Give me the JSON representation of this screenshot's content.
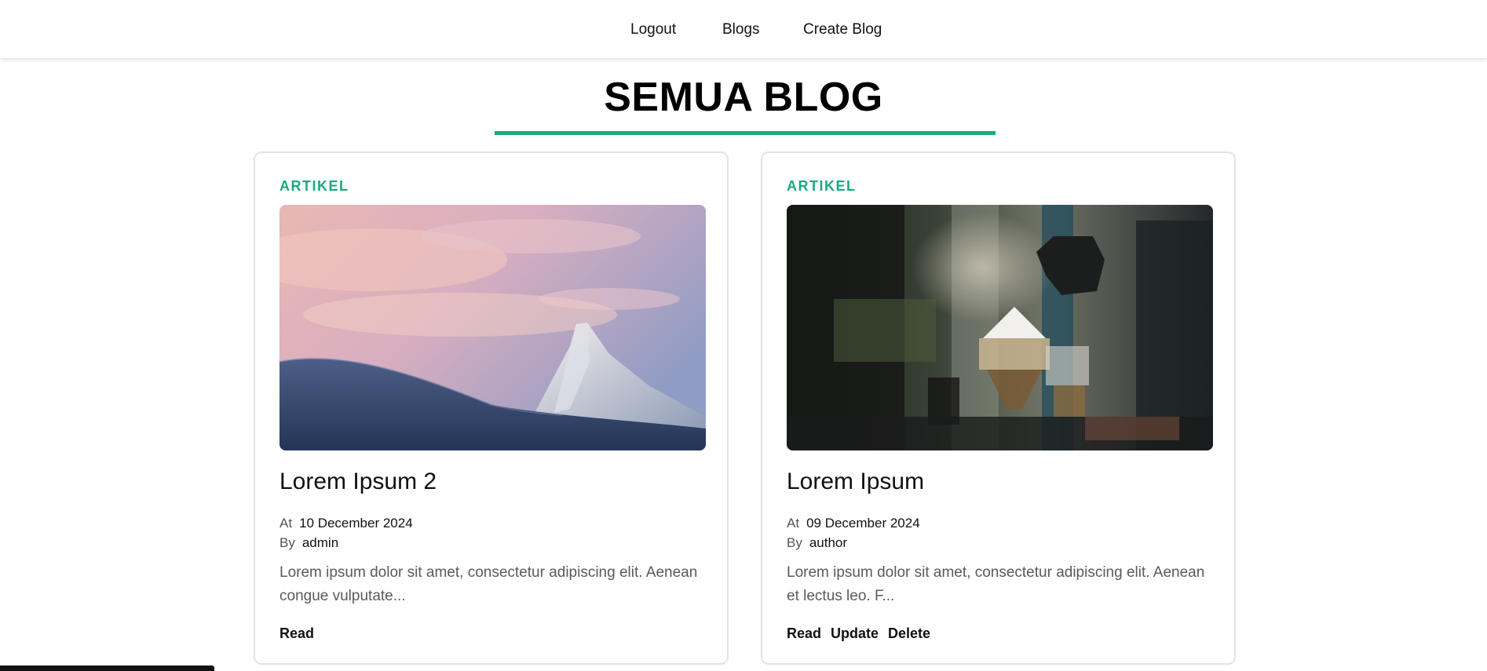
{
  "nav": {
    "links": [
      {
        "label": "Logout"
      },
      {
        "label": "Blogs"
      },
      {
        "label": "Create Blog"
      }
    ]
  },
  "page": {
    "title": "SEMUA BLOG",
    "accent_color": "#1aaa7f"
  },
  "posts": [
    {
      "category": "ARTIKEL",
      "image_subject": "snowy-mountain-peak-at-sunset",
      "title": "Lorem Ipsum 2",
      "date_label": "At",
      "date": "10 December 2024",
      "author_label": "By",
      "author": "admin",
      "excerpt": "Lorem ipsum dolor sit amet, consectetur adipiscing elit. Aenean congue vulputate...",
      "actions": [
        "Read"
      ]
    },
    {
      "category": "ARTIKEL",
      "image_subject": "coffee-brewing-equipment",
      "title": "Lorem Ipsum",
      "date_label": "At",
      "date": "09 December 2024",
      "author_label": "By",
      "author": "author",
      "excerpt": "Lorem ipsum dolor sit amet, consectetur adipiscing elit. Aenean et lectus leo. F...",
      "actions": [
        "Read",
        "Update",
        "Delete"
      ]
    }
  ]
}
